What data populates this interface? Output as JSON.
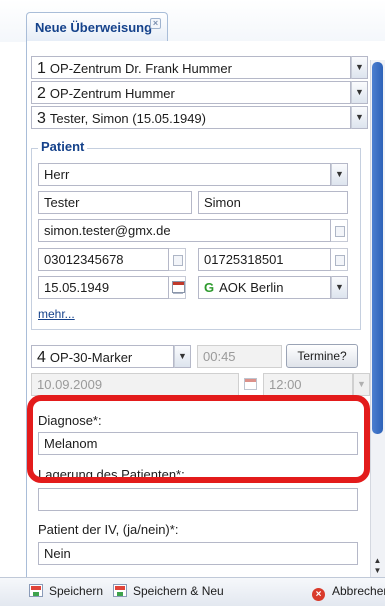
{
  "tab": {
    "title": "Neue Überweisung",
    "close": "×"
  },
  "combos": {
    "source1": {
      "num": "1",
      "text": "OP-Zentrum Dr. Frank Hummer"
    },
    "source2": {
      "num": "2",
      "text": "OP-Zentrum Hummer"
    },
    "patient_select": {
      "num": "3",
      "text": "Tester, Simon (15.05.1949)"
    }
  },
  "patient": {
    "legend": "Patient",
    "salutation": "Herr",
    "last_name": "Tester",
    "first_name": "Simon",
    "email": "simon.tester@gmx.de",
    "phone1": "03012345678",
    "phone2": "01725318501",
    "birthdate": "15.05.1949",
    "insurance_prefix": "G",
    "insurance": "AOK Berlin",
    "more_link": "mehr..."
  },
  "appointment": {
    "num": "4",
    "service": "OP-30-Marker",
    "duration": "00:45",
    "termine_button": "Termine?",
    "date": "10.09.2009",
    "time": "12:00"
  },
  "form": {
    "diagnose_label": "Diagnose*:",
    "diagnose_value": "Melanom",
    "lagerung_label": "Lagerung des Patienten*:",
    "lagerung_value": "",
    "iv_label": "Patient der IV, (ja/nein)*:",
    "iv_value": "Nein"
  },
  "footer": {
    "save": "Speichern",
    "save_new": "Speichern & Neu",
    "cancel": "Abbrechen"
  },
  "colors": {
    "highlight": "#e31b1b",
    "accent": "#15428b"
  }
}
